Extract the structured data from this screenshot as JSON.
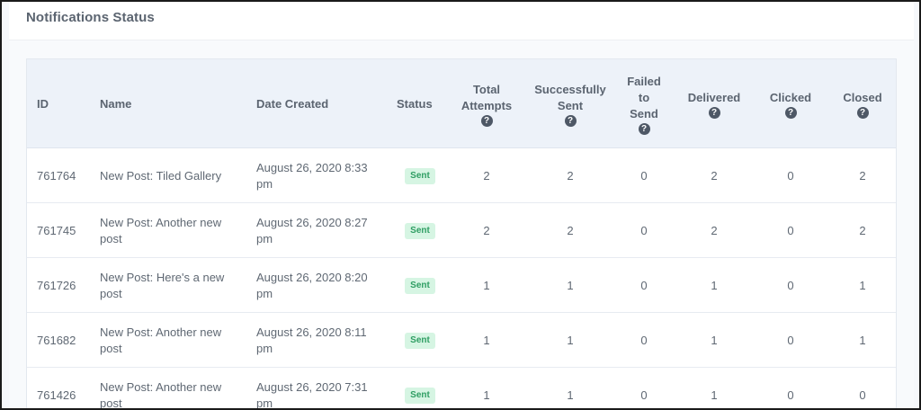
{
  "panel": {
    "title": "Notifications Status"
  },
  "columns": {
    "id": "ID",
    "name": "Name",
    "date": "Date Created",
    "status": "Status",
    "total": [
      "Total",
      "Attempts"
    ],
    "success": [
      "Successfully",
      "Sent"
    ],
    "failed": [
      "Failed",
      "to",
      "Send"
    ],
    "delivered": "Delivered",
    "clicked": "Clicked",
    "closed": "Closed"
  },
  "help_glyph": "?",
  "rows": [
    {
      "id": "761764",
      "name": [
        "New Post: Tiled Gallery"
      ],
      "date": [
        "August 26, 2020 8:33",
        "pm"
      ],
      "status": "Sent",
      "total": "2",
      "success": "2",
      "failed": "0",
      "delivered": "2",
      "clicked": "0",
      "closed": "2"
    },
    {
      "id": "761745",
      "name": [
        "New Post: Another new",
        "post"
      ],
      "date": [
        "August 26, 2020 8:27",
        "pm"
      ],
      "status": "Sent",
      "total": "2",
      "success": "2",
      "failed": "0",
      "delivered": "2",
      "clicked": "0",
      "closed": "2"
    },
    {
      "id": "761726",
      "name": [
        "New Post: Here's a new",
        "post"
      ],
      "date": [
        "August 26, 2020 8:20",
        "pm"
      ],
      "status": "Sent",
      "total": "1",
      "success": "1",
      "failed": "0",
      "delivered": "1",
      "clicked": "0",
      "closed": "1"
    },
    {
      "id": "761682",
      "name": [
        "New Post: Another new",
        "post"
      ],
      "date": [
        "August 26, 2020 8:11",
        "pm"
      ],
      "status": "Sent",
      "total": "1",
      "success": "1",
      "failed": "0",
      "delivered": "1",
      "clicked": "0",
      "closed": "1"
    },
    {
      "id": "761426",
      "name": [
        "New Post: Another new",
        "post"
      ],
      "date": [
        "August 26, 2020 7:31",
        "pm"
      ],
      "status": "Sent",
      "total": "1",
      "success": "1",
      "failed": "0",
      "delivered": "1",
      "clicked": "0",
      "closed": "0"
    }
  ],
  "colors": {
    "badge_text": "#2f9e63",
    "badge_bg": "#d6f5e3",
    "header_bg": "#edf2f9"
  },
  "icons": {
    "help": "question-circle-icon"
  }
}
